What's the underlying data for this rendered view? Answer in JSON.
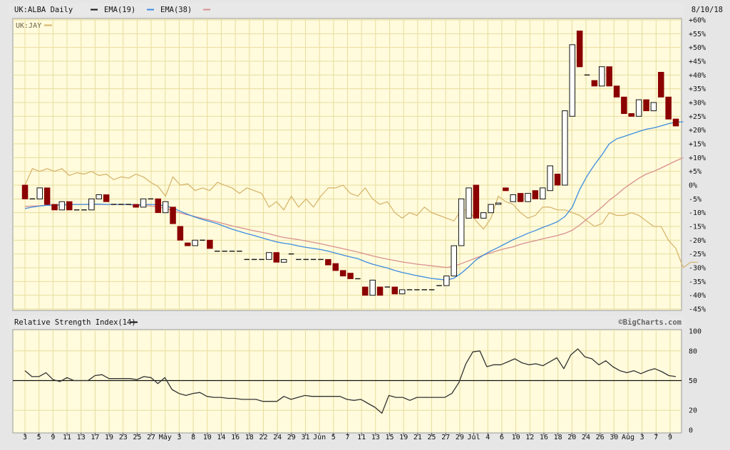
{
  "header": {
    "symbol": "UK:ALBA Daily",
    "ema19": "EMA(19)",
    "ema38": "EMA(38)",
    "date": "8/10/18",
    "compare_symbol": "UK:JAY"
  },
  "rsi_panel": {
    "title": "Relative Strength Index(14)",
    "brand": "©BigCharts.com"
  },
  "colors": {
    "background": "#fffbdc",
    "grid": "#e7dc9e",
    "up_candle_fill": "#ffffff",
    "down_candle_fill": "#8b0000",
    "candle_outline": "#111111",
    "ema19": "#3c8be0",
    "ema38": "#d88f8f",
    "compare": "#d5b267",
    "rsi": "#333333"
  },
  "chart_data": [
    {
      "type": "candlestick",
      "title": "UK:ALBA Daily",
      "y_unit": "% change",
      "ylim": [
        -45,
        60
      ],
      "y_ticks": [
        "+60%",
        "+55%",
        "+50%",
        "+45%",
        "+40%",
        "+35%",
        "+30%",
        "+25%",
        "+20%",
        "+15%",
        "+10%",
        "+5%",
        "0%",
        "-5%",
        "-10%",
        "-15%",
        "-20%",
        "-25%",
        "-30%",
        "-35%",
        "-40%",
        "-45%"
      ],
      "x_ticks": [
        "3",
        "5",
        "9",
        "11",
        "13",
        "17",
        "19",
        "23",
        "25",
        "27",
        "May",
        "3",
        "8",
        "10",
        "14",
        "16",
        "18",
        "22",
        "24",
        "29",
        "31",
        "Jun",
        "5",
        "7",
        "11",
        "13",
        "15",
        "19",
        "21",
        "25",
        "27",
        "29",
        "Jul",
        "4",
        "6",
        "10",
        "12",
        "16",
        "18",
        "20",
        "24",
        "26",
        "30",
        "Aug",
        "3",
        "7",
        "9"
      ],
      "grid": true,
      "candles": [
        {
          "o": 0,
          "c": -5,
          "h": 0,
          "l": -5
        },
        {
          "o": -5,
          "c": -5,
          "h": -5,
          "l": -5
        },
        {
          "o": -5,
          "c": -1,
          "h": -1,
          "l": -5
        },
        {
          "o": -1,
          "c": -7,
          "h": -1,
          "l": -7
        },
        {
          "o": -7,
          "c": -9,
          "h": -7,
          "l": -9
        },
        {
          "o": -9,
          "c": -6,
          "h": -6,
          "l": -9
        },
        {
          "o": -6,
          "c": -9,
          "h": -6,
          "l": -9
        },
        {
          "o": -9,
          "c": -9,
          "h": -9,
          "l": -9
        },
        {
          "o": -9,
          "c": -9,
          "h": -9,
          "l": -9
        },
        {
          "o": -9,
          "c": -5,
          "h": -5,
          "l": -9
        },
        {
          "o": -5,
          "c": -3.5,
          "h": -3.5,
          "l": -5
        },
        {
          "o": -3.5,
          "c": -6,
          "h": -3.5,
          "l": -6
        },
        {
          "o": -7,
          "c": -7,
          "h": -7,
          "l": -7
        },
        {
          "o": -7,
          "c": -7,
          "h": -7,
          "l": -7
        },
        {
          "o": -7,
          "c": -7,
          "h": -7,
          "l": -7
        },
        {
          "o": -7,
          "c": -8,
          "h": -7,
          "l": -8
        },
        {
          "o": -8,
          "c": -5,
          "h": -5,
          "l": -8
        },
        {
          "o": -5,
          "c": -5,
          "h": -5,
          "l": -5
        },
        {
          "o": -5,
          "c": -10,
          "h": -5,
          "l": -10
        },
        {
          "o": -10,
          "c": -6,
          "h": -6,
          "l": -10
        },
        {
          "o": -8,
          "c": -14,
          "h": -8,
          "l": -14
        },
        {
          "o": -15,
          "c": -20,
          "h": -15,
          "l": -20
        },
        {
          "o": -21,
          "c": -22,
          "h": -21,
          "l": -22
        },
        {
          "o": -22,
          "c": -20,
          "h": -20,
          "l": -22
        },
        {
          "o": -20,
          "c": -20,
          "h": -20,
          "l": -20
        },
        {
          "o": -20,
          "c": -23,
          "h": -20,
          "l": -23
        },
        {
          "o": -24,
          "c": -24,
          "h": -24,
          "l": -24
        },
        {
          "o": -24,
          "c": -24,
          "h": -24,
          "l": -24
        },
        {
          "o": -24,
          "c": -24,
          "h": -24,
          "l": -24
        },
        {
          "o": -24,
          "c": -24,
          "h": -24,
          "l": -24
        },
        {
          "o": -27,
          "c": -27,
          "h": -27,
          "l": -27
        },
        {
          "o": -27,
          "c": -27,
          "h": -27,
          "l": -27
        },
        {
          "o": -27,
          "c": -27,
          "h": -27,
          "l": -27
        },
        {
          "o": -27,
          "c": -24.5,
          "h": -24.5,
          "l": -27
        },
        {
          "o": -24.5,
          "c": -28,
          "h": -24.5,
          "l": -28
        },
        {
          "o": -28,
          "c": -27,
          "h": -27,
          "l": -28
        },
        {
          "o": -25,
          "c": -25,
          "h": -25,
          "l": -25
        },
        {
          "o": -27,
          "c": -27,
          "h": -27,
          "l": -27
        },
        {
          "o": -27,
          "c": -27,
          "h": -27,
          "l": -27
        },
        {
          "o": -27,
          "c": -27,
          "h": -27,
          "l": -27
        },
        {
          "o": -27,
          "c": -27,
          "h": -27,
          "l": -27
        },
        {
          "o": -27,
          "c": -29,
          "h": -27,
          "l": -29
        },
        {
          "o": -28.5,
          "c": -31,
          "h": -28.5,
          "l": -31
        },
        {
          "o": -31,
          "c": -33,
          "h": -31,
          "l": -33
        },
        {
          "o": -32,
          "c": -34,
          "h": -32,
          "l": -34
        },
        {
          "o": -34,
          "c": -34,
          "h": -34,
          "l": -34
        },
        {
          "o": -37,
          "c": -40,
          "h": -37,
          "l": -40
        },
        {
          "o": -40,
          "c": -34.5,
          "h": -34.5,
          "l": -40
        },
        {
          "o": -37,
          "c": -40,
          "h": -37,
          "l": -40
        },
        {
          "o": -37,
          "c": -37,
          "h": -37,
          "l": -37
        },
        {
          "o": -37,
          "c": -39.5,
          "h": -37,
          "l": -39.5
        },
        {
          "o": -39.5,
          "c": -38,
          "h": -38,
          "l": -39.5
        },
        {
          "o": -38,
          "c": -38,
          "h": -38,
          "l": -38
        },
        {
          "o": -38,
          "c": -38,
          "h": -38,
          "l": -38
        },
        {
          "o": -38,
          "c": -38,
          "h": -38,
          "l": -38
        },
        {
          "o": -38,
          "c": -38,
          "h": -38,
          "l": -38
        },
        {
          "o": -36.5,
          "c": -36.5,
          "h": -36.5,
          "l": -36.5
        },
        {
          "o": -36.5,
          "c": -33,
          "h": -33,
          "l": -36.5
        },
        {
          "o": -33,
          "c": -22,
          "h": -22,
          "l": -33
        },
        {
          "o": -22,
          "c": -5,
          "h": -5,
          "l": -22
        },
        {
          "o": -12,
          "c": -1,
          "h": -1,
          "l": -12
        },
        {
          "o": 0,
          "c": -12,
          "h": 0,
          "l": -12
        },
        {
          "o": -12,
          "c": -10,
          "h": -10,
          "l": -12
        },
        {
          "o": -10,
          "c": -7,
          "h": -7,
          "l": -10
        },
        {
          "o": -7,
          "c": -6.5,
          "h": -6.5,
          "l": -7
        },
        {
          "o": -1,
          "c": -2,
          "h": -1,
          "l": -2
        },
        {
          "o": -6,
          "c": -3.5,
          "h": -3.5,
          "l": -6
        },
        {
          "o": -3,
          "c": -6,
          "h": -3,
          "l": -6
        },
        {
          "o": -6,
          "c": -3,
          "h": -3,
          "l": -6
        },
        {
          "o": -2,
          "c": -5,
          "h": -2,
          "l": -5
        },
        {
          "o": -5,
          "c": -1,
          "h": -1,
          "l": -5
        },
        {
          "o": -2,
          "c": 7,
          "h": 7,
          "l": -2
        },
        {
          "o": 4,
          "c": 0,
          "h": 4,
          "l": 0
        },
        {
          "o": 0,
          "c": 27,
          "h": 27,
          "l": 0
        },
        {
          "o": 25,
          "c": 51,
          "h": 51,
          "l": 25
        },
        {
          "o": 56,
          "c": 43,
          "h": 56,
          "l": 43
        },
        {
          "o": 40,
          "c": 40,
          "h": 40,
          "l": 40
        },
        {
          "o": 38,
          "c": 36,
          "h": 38,
          "l": 36
        },
        {
          "o": 36,
          "c": 43,
          "h": 43,
          "l": 36
        },
        {
          "o": 43,
          "c": 36,
          "h": 43,
          "l": 36
        },
        {
          "o": 36,
          "c": 32,
          "h": 36,
          "l": 32
        },
        {
          "o": 32,
          "c": 26,
          "h": 32,
          "l": 26
        },
        {
          "o": 26,
          "c": 25,
          "h": 26,
          "l": 25
        },
        {
          "o": 25,
          "c": 31,
          "h": 31,
          "l": 25
        },
        {
          "o": 31,
          "c": 27,
          "h": 31,
          "l": 27
        },
        {
          "o": 27,
          "c": 30,
          "h": 30,
          "l": 27
        },
        {
          "o": 41,
          "c": 32,
          "h": 41,
          "l": 32
        },
        {
          "o": 32,
          "c": 24,
          "h": 32,
          "l": 24
        },
        {
          "o": 24,
          "c": 21.5,
          "h": 24,
          "l": 21.5
        }
      ],
      "ema19": [
        -8.5,
        -8,
        -7.6,
        -7.3,
        -7.3,
        -7.2,
        -7.1,
        -7,
        -7,
        -6.9,
        -6.9,
        -7,
        -7,
        -7,
        -7,
        -7.1,
        -7.1,
        -7,
        -7.2,
        -7.5,
        -8.3,
        -9.5,
        -10.6,
        -11.6,
        -12.5,
        -13.2,
        -14,
        -15,
        -16,
        -16.8,
        -17.6,
        -18.3,
        -19.1,
        -19.9,
        -20.6,
        -21.1,
        -21.5,
        -22.1,
        -22.6,
        -23,
        -23.4,
        -24,
        -24.7,
        -25.4,
        -26.1,
        -26.7,
        -27.8,
        -28.7,
        -29.4,
        -30.1,
        -31,
        -31.7,
        -32.3,
        -32.9,
        -33.4,
        -33.9,
        -34.2,
        -34.5,
        -33.8,
        -32,
        -29.7,
        -27.1,
        -25.4,
        -23.9,
        -22.6,
        -21.2,
        -19.8,
        -18.7,
        -17.5,
        -16.5,
        -15.4,
        -14.4,
        -13.3,
        -11.4,
        -8,
        -1.6,
        3.3,
        7.4,
        11,
        15,
        16.8,
        17.7,
        18.6,
        19.5,
        20.3,
        20.8,
        21.5,
        22.3,
        22.9,
        23
      ],
      "ema38": [
        -7.7,
        -7.6,
        -7.5,
        -7.3,
        -7.2,
        -7.1,
        -7,
        -7,
        -7,
        -7,
        -7,
        -7,
        -7,
        -7,
        -7.1,
        -7.2,
        -7.4,
        -7.6,
        -7.9,
        -8.5,
        -9.3,
        -10.1,
        -10.8,
        -11.4,
        -12.1,
        -12.7,
        -13.4,
        -14.1,
        -14.8,
        -15.4,
        -16,
        -16.6,
        -17.1,
        -17.7,
        -18.4,
        -19,
        -19.4,
        -19.8,
        -20.3,
        -20.8,
        -21.3,
        -21.9,
        -22.5,
        -23.1,
        -23.7,
        -24.3,
        -25,
        -25.7,
        -26.3,
        -26.9,
        -27.4,
        -27.9,
        -28.3,
        -28.7,
        -29,
        -29.3,
        -29.6,
        -29.9,
        -29.5,
        -28.5,
        -27.5,
        -26.4,
        -25.4,
        -24.6,
        -23.7,
        -23,
        -22.4,
        -21.5,
        -20.8,
        -20.2,
        -19.5,
        -18.9,
        -18.3,
        -17.5,
        -16.4,
        -14.5,
        -12.3,
        -10.2,
        -8,
        -5.5,
        -3.5,
        -1.2,
        0.7,
        2.5,
        4,
        5,
        6.2,
        7.5,
        8.8,
        10
      ],
      "compare_jay": [
        0,
        6,
        5,
        6,
        5,
        6,
        3.5,
        4.5,
        4,
        5,
        3.5,
        4,
        2,
        3,
        2.5,
        4,
        3,
        1,
        -0.5,
        -4,
        3,
        0,
        0.5,
        -2,
        -1,
        -2,
        1,
        0,
        -1,
        -3,
        -1,
        -2,
        -3,
        -8,
        -6,
        -9,
        -4,
        -8,
        -5,
        -8,
        -4,
        -1,
        -1,
        0,
        -3,
        -4,
        -1,
        -5,
        -7,
        -6,
        -10,
        -12,
        -10,
        -11,
        -8,
        -10,
        -11,
        -12,
        -13,
        -9,
        -9,
        -13,
        -16,
        -12,
        -4,
        -6,
        -7,
        -10,
        -12,
        -11,
        -8,
        -8,
        -9,
        -9,
        -10,
        -11,
        -13,
        -15,
        -14,
        -10,
        -11,
        -11,
        -10,
        -11,
        -13,
        -15,
        -15,
        -20,
        -23,
        -30,
        -28,
        -28
      ]
    },
    {
      "type": "line",
      "title": "Relative Strength Index(14)",
      "ylim": [
        0,
        100
      ],
      "y_ticks": [
        100,
        80,
        50,
        20,
        0
      ],
      "reference_line": 50,
      "x_ticks": [
        "3",
        "5",
        "9",
        "11",
        "13",
        "17",
        "19",
        "23",
        "25",
        "27",
        "May",
        "3",
        "8",
        "10",
        "14",
        "16",
        "18",
        "22",
        "24",
        "29",
        "31",
        "Jun",
        "5",
        "7",
        "11",
        "13",
        "15",
        "19",
        "21",
        "25",
        "27",
        "29",
        "Jul",
        "4",
        "6",
        "10",
        "12",
        "16",
        "18",
        "20",
        "24",
        "26",
        "30",
        "Aug",
        "3",
        "7",
        "9"
      ],
      "values": [
        60,
        54,
        54,
        58,
        51,
        49,
        53,
        50,
        50,
        50,
        55,
        56,
        52,
        52,
        52,
        52,
        51,
        54,
        53,
        47,
        53,
        41,
        37,
        35,
        37,
        38,
        34,
        33,
        33,
        32,
        32,
        31,
        31,
        31,
        29,
        29,
        29,
        34,
        31,
        33,
        35,
        34,
        34,
        34,
        34,
        34,
        31,
        30,
        31,
        27,
        23,
        17,
        35,
        33,
        33,
        30,
        33,
        33,
        33,
        33,
        33,
        37,
        48,
        67,
        79,
        80,
        64,
        66,
        66,
        69,
        72,
        68,
        66,
        67,
        65,
        69,
        73,
        62,
        76,
        82,
        74,
        72,
        66,
        70,
        64,
        60,
        58,
        60,
        57,
        60,
        62,
        59,
        55,
        54
      ]
    }
  ]
}
